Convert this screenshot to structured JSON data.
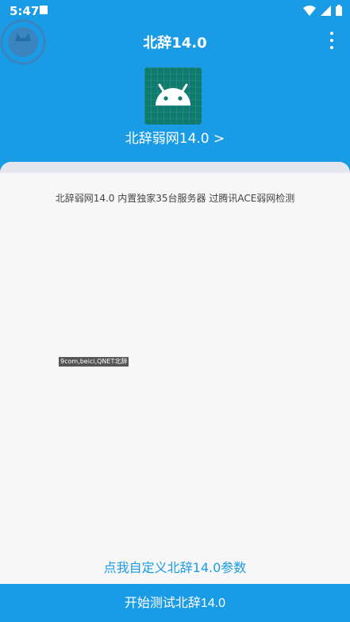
{
  "status_bar": {
    "time": "5:47"
  },
  "toolbar": {
    "title": "北辞14.0"
  },
  "app": {
    "name_link": "北辞弱网14.0 >"
  },
  "card": {
    "description": "北辞弱网14.0 内置独家35台服务器 过腾讯ACE弱网检测",
    "tag": "9com,beici,QNET北辞",
    "custom_link": "点我自定义北辞14.0参数"
  },
  "start_button": {
    "label": "开始测试北辞14.0"
  },
  "colors": {
    "primary": "#1a9be6",
    "icon_bg": "#0f7a6e",
    "card_bg": "#f7f7f7"
  }
}
